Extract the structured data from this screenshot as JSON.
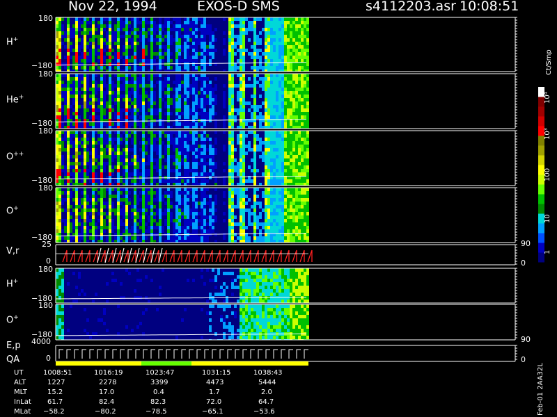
{
  "header": {
    "date": "Nov 22, 1994",
    "instrument": "EXOS-D SMS",
    "file": "s4112203.asr",
    "time": "10:08:51"
  },
  "colorbar": {
    "unit": "Ct/Smp",
    "ticks": [
      "1",
      "10",
      "100",
      "10³",
      "10⁴"
    ],
    "colors": [
      "#000080",
      "#0000c0",
      "#0050ff",
      "#00a0ff",
      "#00d8d8",
      "#008a00",
      "#00c000",
      "#66ff00",
      "#ccff00",
      "#ffff00",
      "#d4d400",
      "#a0a000",
      "#808000",
      "#ff0000",
      "#d00000",
      "#a00000",
      "#800000",
      "#ffffff"
    ]
  },
  "panels": [
    {
      "id": "h-plus-1",
      "label": "H",
      "sup": "+",
      "ytop": "180",
      "ybot": "−180"
    },
    {
      "id": "he-plus",
      "label": "He",
      "sup": "+",
      "ytop": "180",
      "ybot": "−180"
    },
    {
      "id": "o-pp",
      "label": "O",
      "sup": "++",
      "ytop": "180",
      "ybot": "−180"
    },
    {
      "id": "o-plus-1",
      "label": "O",
      "sup": "+",
      "ytop": "180",
      "ybot": "−180"
    },
    {
      "id": "vr",
      "label": "V,r",
      "sup": "",
      "ytop": "25",
      "ybot": "0",
      "rtop": "90",
      "rbot": "0"
    },
    {
      "id": "h-plus-2",
      "label": "H",
      "sup": "+",
      "ytop": "180",
      "ybot": "−180"
    },
    {
      "id": "o-plus-2",
      "label": "O",
      "sup": "+",
      "ytop": "180",
      "ybot": "−180"
    },
    {
      "id": "ep",
      "label": "E,p",
      "sup": "",
      "label2": "QA",
      "ytop": "4000",
      "ybot": "0",
      "rtop": "90",
      "rbot": "0"
    }
  ],
  "footer": {
    "row_labels": [
      "UT",
      "ALT",
      "MLT",
      "InLat",
      "MLat"
    ],
    "columns": [
      [
        "1008:51",
        "1227",
        "15.2",
        "61.7",
        "−58.2"
      ],
      [
        "1016:19",
        "2278",
        "17.0",
        "82.4",
        "−80.2"
      ],
      [
        "1023:47",
        "3399",
        "0.4",
        "82.3",
        "−78.5"
      ],
      [
        "1031:15",
        "4473",
        "1.7",
        "72.0",
        "−65.1"
      ],
      [
        "1038:43",
        "5444",
        "2.0",
        "64.7",
        "−53.6"
      ]
    ],
    "side_note": "Feb-01 2AA32L"
  },
  "chart_data": {
    "type": "heatmap",
    "title": "Nov 22, 1994   EXOS-D SMS",
    "time_ticks": [
      "1008:51",
      "1016:19",
      "1023:47",
      "1031:15",
      "1038:43"
    ],
    "color_scale": {
      "unit": "Ct/Smp",
      "ticks": [
        "1",
        "10",
        "100",
        "10³",
        "10⁴"
      ],
      "log": true
    },
    "panels": [
      {
        "name": "H+",
        "ylim": [
          -180,
          180
        ]
      },
      {
        "name": "He+",
        "ylim": [
          -180,
          180
        ]
      },
      {
        "name": "O++",
        "ylim": [
          -180,
          180
        ]
      },
      {
        "name": "O+",
        "ylim": [
          -180,
          180
        ]
      },
      {
        "name": "V,r",
        "ylim": [
          0,
          25
        ],
        "right_ylim": [
          0,
          90
        ]
      },
      {
        "name": "H+",
        "ylim": [
          -180,
          180
        ]
      },
      {
        "name": "O+",
        "ylim": [
          -180,
          180
        ]
      },
      {
        "name": "E,p",
        "ylim": [
          0,
          4000
        ],
        "right_ylim": [
          0,
          90
        ]
      }
    ]
  }
}
